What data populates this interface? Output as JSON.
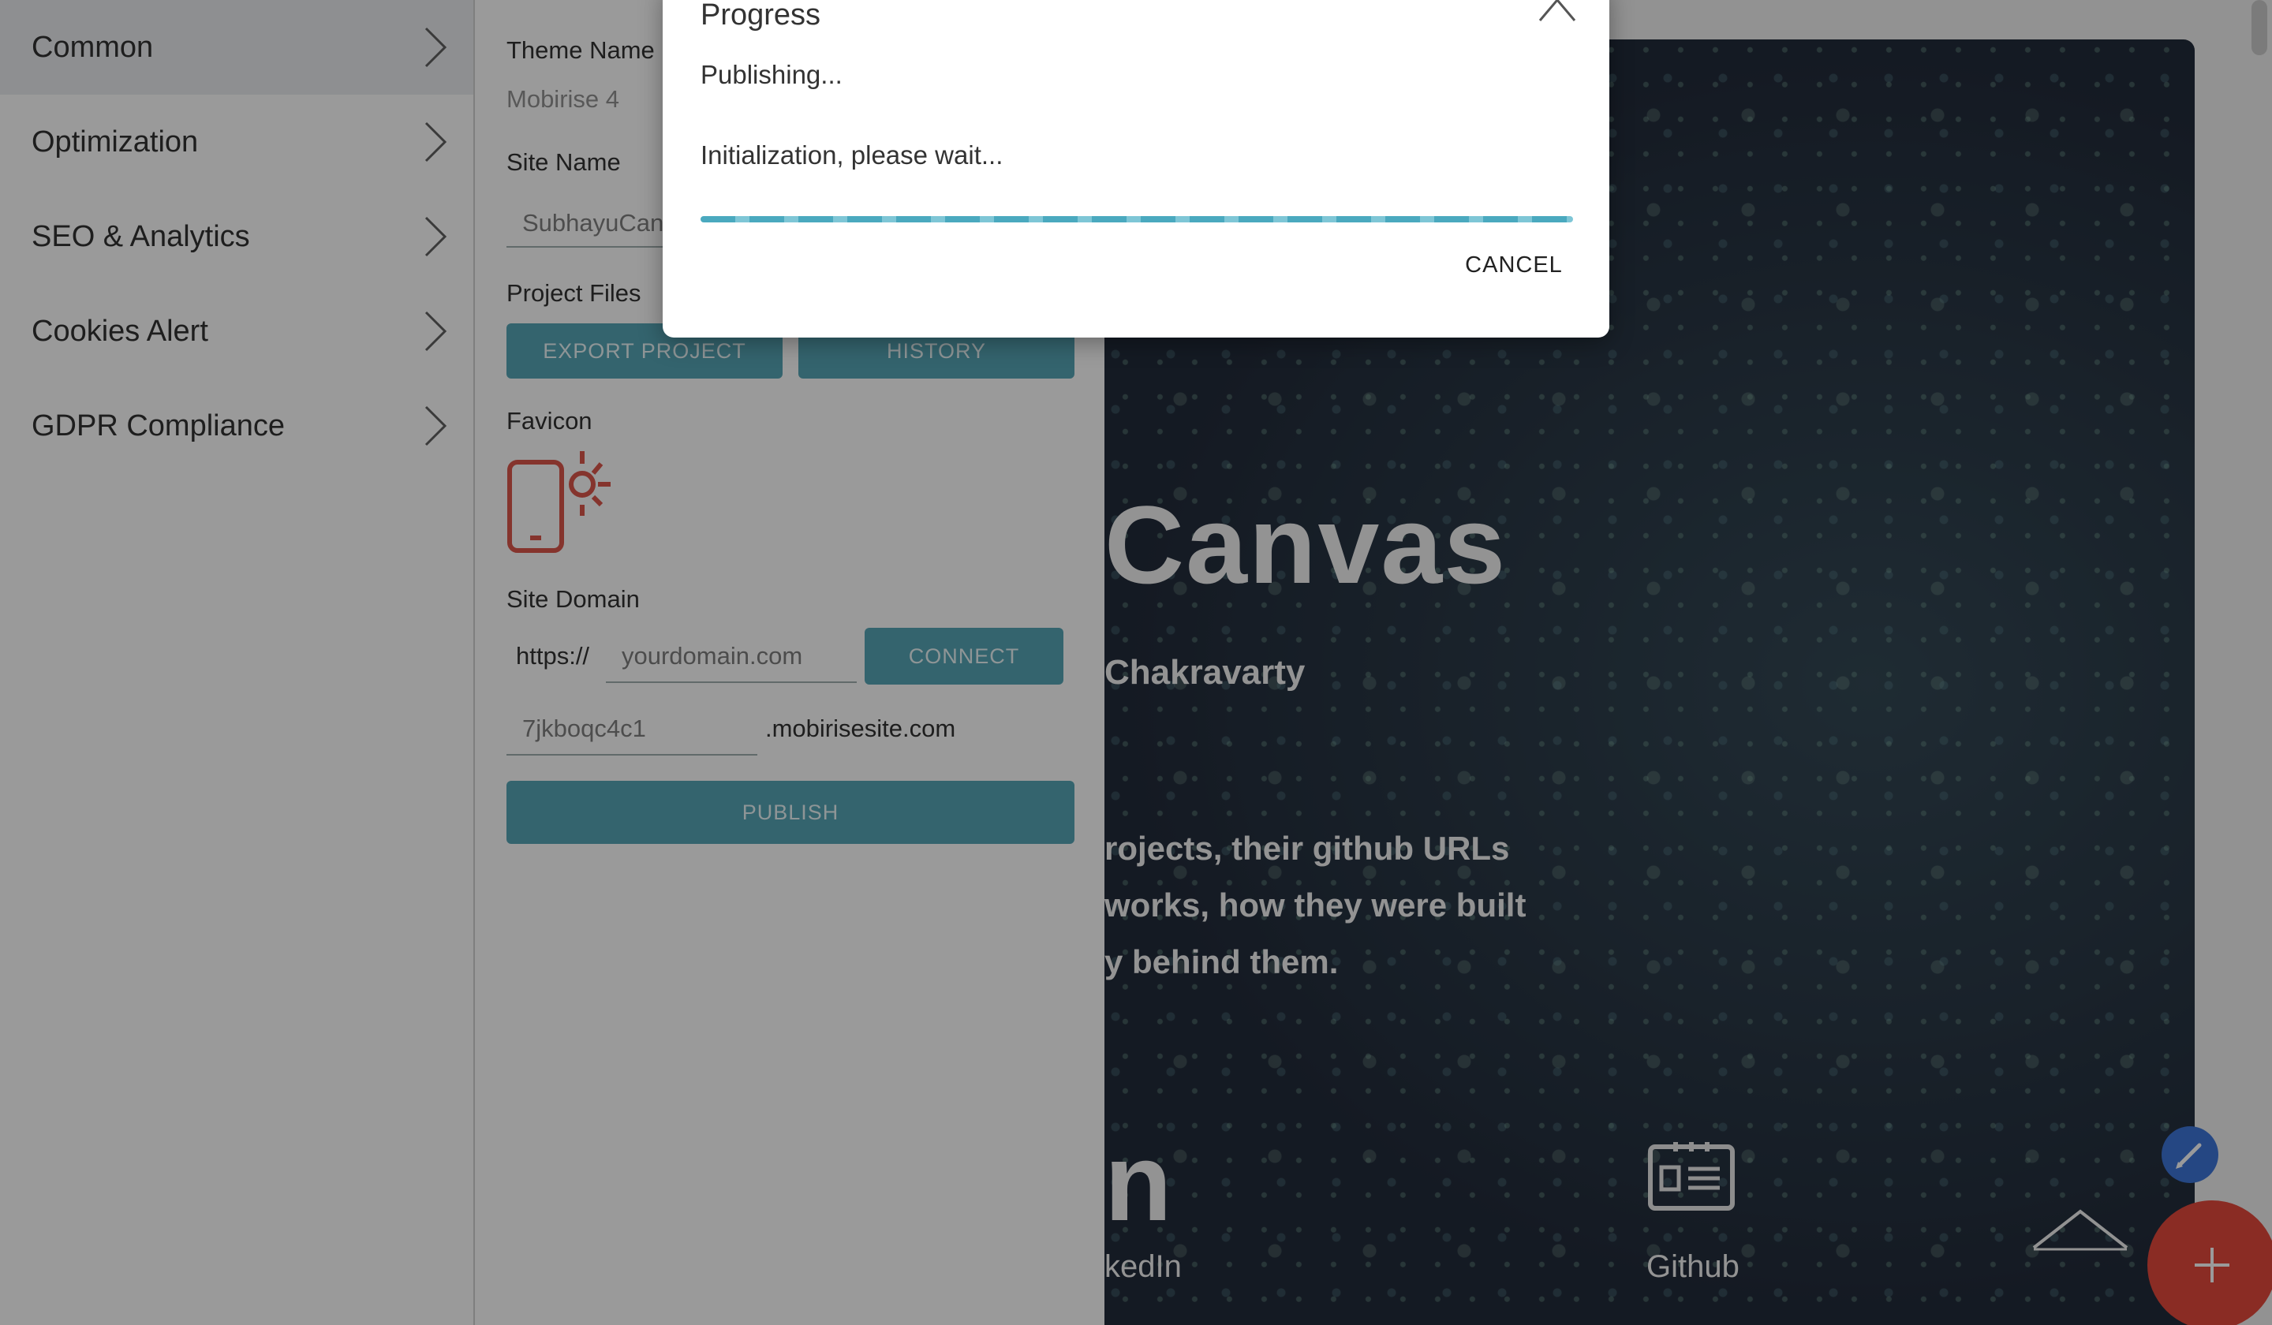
{
  "sidebar": {
    "items": [
      {
        "label": "Common"
      },
      {
        "label": "Optimization"
      },
      {
        "label": "SEO & Analytics"
      },
      {
        "label": "Cookies Alert"
      },
      {
        "label": "GDPR Compliance"
      }
    ],
    "active_index": 0
  },
  "settings": {
    "theme_name_label": "Theme Name",
    "theme_name_value": "Mobirise 4",
    "site_name_label": "Site Name",
    "site_name_value": "SubhayuCanv",
    "project_files_label": "Project Files",
    "export_button": "EXPORT PROJECT",
    "history_button": "HISTORY",
    "favicon_label": "Favicon",
    "site_domain_label": "Site Domain",
    "protocol": "https://",
    "domain_placeholder": "yourdomain.com",
    "connect_button": "CONNECT",
    "subdomain_value": "7jkboqc4c1",
    "subdomain_suffix": ".mobirisesite.com",
    "publish_button": "PUBLISH"
  },
  "preview": {
    "title_fragment": "Canvas",
    "author_fragment": "Chakravarty",
    "description_fragment": "rojects, their github URLs\nworks, how they were built\ny behind them.",
    "big_letter_fragment": "n",
    "linkedin_fragment": "kedIn",
    "github_label": "Github"
  },
  "modal": {
    "title": "Progress",
    "status": "Publishing...",
    "step": "Initialization, please wait...",
    "progress": 1.0,
    "cancel_button": "CANCEL"
  },
  "colors": {
    "accent": "#4a9fb0",
    "favicon": "#d9493e",
    "fab_add": "#e23b2e",
    "fab_edit": "#2f6bd6"
  },
  "icons": {
    "chevron": "chevron-right-icon",
    "favicon": "phone-sun-icon",
    "github": "id-card-icon",
    "close": "close-icon",
    "edit": "pencil-icon",
    "add": "plus-icon",
    "scroll_up": "chevron-up-icon"
  }
}
